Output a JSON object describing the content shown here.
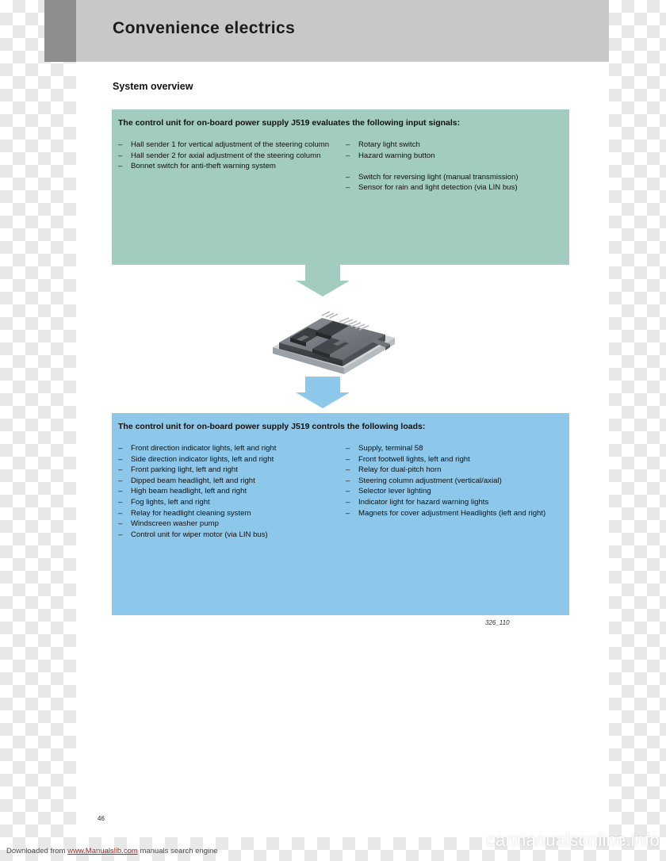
{
  "header": {
    "title": "Convenience electrics"
  },
  "section": {
    "title": "System overview"
  },
  "inputs_box": {
    "heading": "The control unit for on-board power supply J519 evaluates the following input signals:",
    "dash": "–",
    "left_items": [
      "Hall sender 1 for vertical adjustment of the steering column",
      "Hall sender 2 for axial adjustment of the steering column",
      "Bonnet switch for anti-theft warning system"
    ],
    "right_items": [
      "Rotary light switch",
      "Hazard warning button",
      "Switch for reversing light (manual transmission)",
      "Sensor for rain and light detection (via LIN bus)"
    ]
  },
  "loads_box": {
    "heading": "The control unit for on-board power supply J519 controls the following loads:",
    "dash": "–",
    "left_items": [
      "Front direction indicator lights, left and right",
      "Side direction indicator lights, left and right",
      "Front parking light, left and right",
      "Dipped beam headlight, left and right",
      "High beam headlight, left and right",
      "Fog lights, left and right",
      "Relay for headlight cleaning system",
      "Windscreen washer pump",
      "Control unit for wiper motor (via LIN bus)"
    ],
    "right_items": [
      "Supply, terminal 58",
      "Front footwell lights, left and right",
      "Relay for dual-pitch horn",
      "Steering column adjustment (vertical/axial)",
      "Selector lever lighting",
      "Indicator light for hazard warning lights",
      "Magnets for cover adjustment Headlights (left and right)"
    ]
  },
  "figure": {
    "code": "326_110",
    "alt": "control-unit-illustration"
  },
  "page": {
    "number": "46"
  },
  "footer": {
    "prefix": "Downloaded from ",
    "link": "www.Manualslib.com",
    "suffix": " manuals search engine",
    "watermark": "carmanualsonline.info"
  },
  "colors": {
    "green_box": "#a3ccc0",
    "blue_box": "#8dc8ea",
    "green_tab": "#62bb57",
    "header_band": "#c8c8c8",
    "header_dark": "#8d8d8d",
    "link": "#9e2a2a"
  }
}
